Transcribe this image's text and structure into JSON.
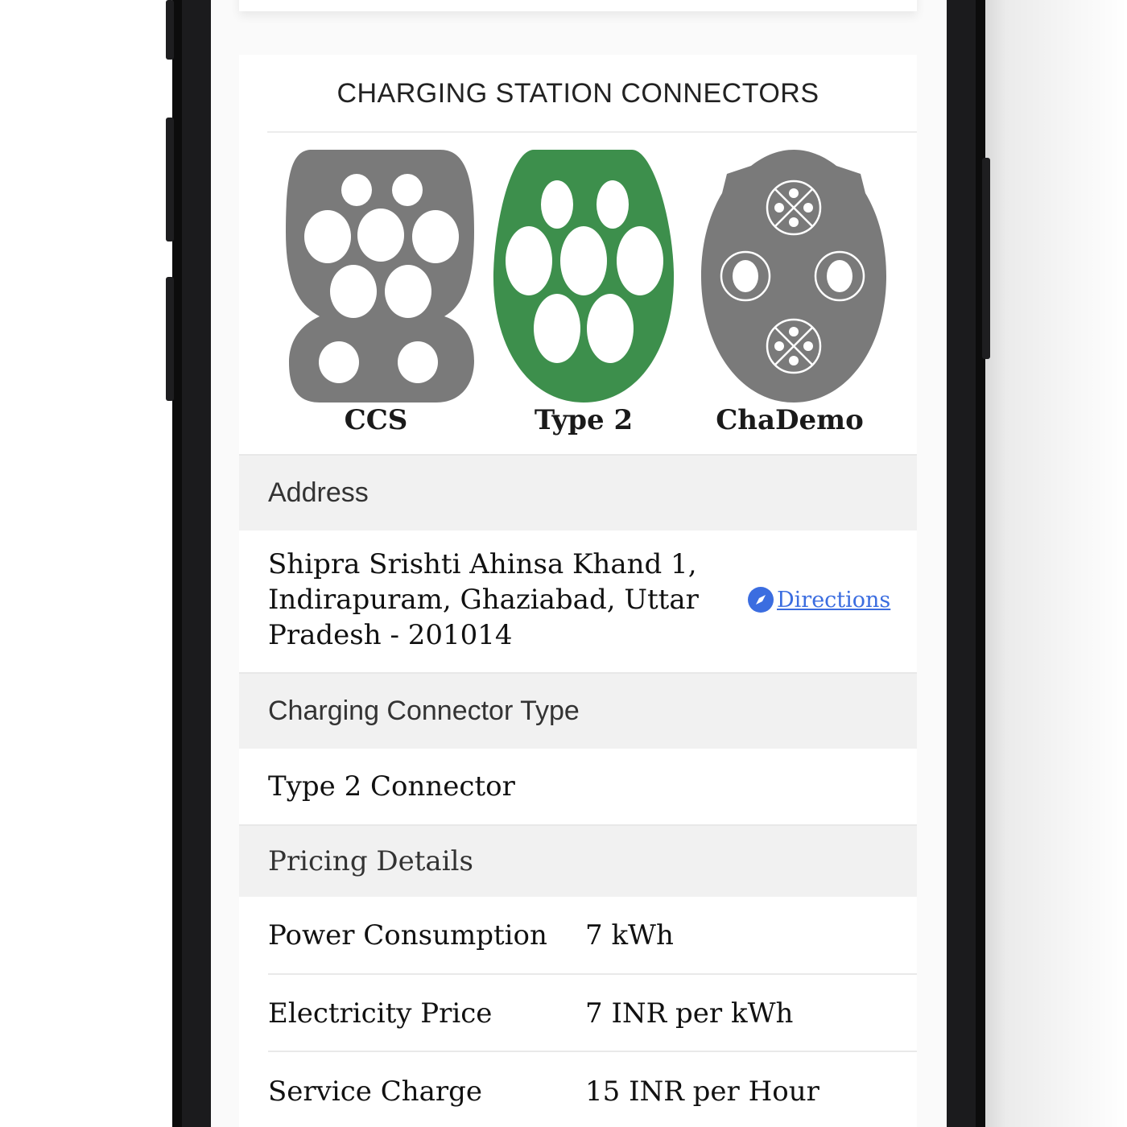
{
  "card": {
    "title": "CHARGING STATION CONNECTORS"
  },
  "connectors": [
    {
      "label": "CCS",
      "color": "#7a7a7a",
      "icon": "ccs-connector-icon"
    },
    {
      "label": "Type 2",
      "color": "#3d8f4c",
      "icon": "type2-connector-icon"
    },
    {
      "label": "ChaDemo",
      "color": "#7a7a7a",
      "icon": "chademo-connector-icon"
    }
  ],
  "address": {
    "heading": "Address",
    "lines": [
      "Shipra Srishti Ahinsa Khand 1,",
      "Indirapuram, Ghaziabad, Uttar",
      "Pradesh - 201014"
    ],
    "directions_label": "Directions",
    "directions_icon": "compass-icon",
    "link_color": "#3b6de0"
  },
  "connector_type": {
    "heading": "Charging Connector Type",
    "value": "Type 2 Connector"
  },
  "pricing": {
    "heading": "Pricing Details",
    "rows": [
      {
        "label": "Power Consumption",
        "value": "7 kWh"
      },
      {
        "label": "Electricity Price",
        "value": "7 INR per kWh"
      },
      {
        "label": "Service Charge",
        "value": "15 INR per Hour"
      }
    ]
  }
}
